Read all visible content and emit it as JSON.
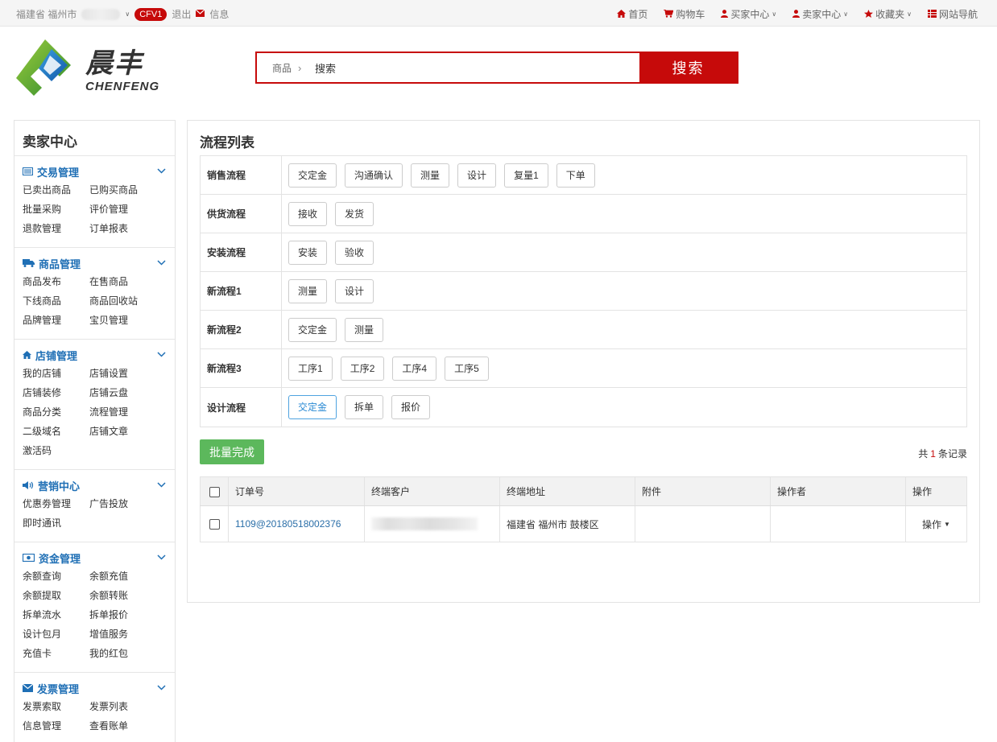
{
  "topbar": {
    "location": "福建省 福州市",
    "level_badge": "CFV1",
    "logout": "退出",
    "message": "信息",
    "nav": [
      {
        "icon": "home-icon",
        "label": "首页",
        "dropdown": false
      },
      {
        "icon": "cart-icon",
        "label": "购物车",
        "dropdown": false
      },
      {
        "icon": "user-icon",
        "label": "买家中心",
        "dropdown": true
      },
      {
        "icon": "user-icon",
        "label": "卖家中心",
        "dropdown": true
      },
      {
        "icon": "star-icon",
        "label": "收藏夹",
        "dropdown": true
      },
      {
        "icon": "grid-icon",
        "label": "网站导航",
        "dropdown": false
      }
    ]
  },
  "logo": {
    "cn": "晨丰",
    "en": "CHENFENG"
  },
  "search": {
    "category": "商品",
    "value": "搜索",
    "button": "搜索"
  },
  "sidebar": {
    "title": "卖家中心",
    "sections": [
      {
        "title": "交易管理",
        "icon": "list-icon",
        "items": [
          "已卖出商品",
          "已购买商品",
          "批量采购",
          "评价管理",
          "退款管理",
          "订单报表"
        ]
      },
      {
        "title": "商品管理",
        "icon": "truck-icon",
        "items": [
          "商品发布",
          "在售商品",
          "下线商品",
          "商品回收站",
          "品牌管理",
          "宝贝管理"
        ]
      },
      {
        "title": "店铺管理",
        "icon": "home-icon",
        "items": [
          "我的店铺",
          "店铺设置",
          "店铺装修",
          "店铺云盘",
          "商品分类",
          "流程管理",
          "二级域名",
          "店铺文章",
          "激活码"
        ]
      },
      {
        "title": "营销中心",
        "icon": "volume-icon",
        "items": [
          "优惠劵管理",
          "广告投放",
          "即时通讯"
        ]
      },
      {
        "title": "资金管理",
        "icon": "money-icon",
        "items": [
          "余额查询",
          "余额充值",
          "余额提取",
          "余额转账",
          "拆单流水",
          "拆单报价",
          "设计包月",
          "增值服务",
          "充值卡",
          "我的红包"
        ]
      },
      {
        "title": "发票管理",
        "icon": "envelope-icon",
        "items": [
          "发票索取",
          "发票列表",
          "信息管理",
          "查看账单"
        ]
      }
    ]
  },
  "main": {
    "title": "流程列表",
    "flows": [
      {
        "name": "销售流程",
        "steps": [
          "交定金",
          "沟通确认",
          "测量",
          "设计",
          "复量1",
          "下单"
        ],
        "active": -1
      },
      {
        "name": "供货流程",
        "steps": [
          "接收",
          "发货"
        ],
        "active": -1
      },
      {
        "name": "安装流程",
        "steps": [
          "安装",
          "验收"
        ],
        "active": -1
      },
      {
        "name": "新流程1",
        "steps": [
          "测量",
          "设计"
        ],
        "active": -1
      },
      {
        "name": "新流程2",
        "steps": [
          "交定金",
          "测量"
        ],
        "active": -1
      },
      {
        "name": "新流程3",
        "steps": [
          "工序1",
          "工序2",
          "工序4",
          "工序5"
        ],
        "active": -1
      },
      {
        "name": "设计流程",
        "steps": [
          "交定金",
          "拆单",
          "报价"
        ],
        "active": 0
      }
    ],
    "batch_button": "批量完成",
    "total": {
      "prefix": "共",
      "count": "1",
      "suffix": "条记录"
    },
    "table": {
      "headers": [
        "订单号",
        "终端客户",
        "终端地址",
        "附件",
        "操作者",
        "操作"
      ],
      "rows": [
        {
          "order_no": "1109@20180518002376",
          "customer": "",
          "address": "福建省 福州市 鼓楼区",
          "attachment": "",
          "operator": "",
          "action": "操作"
        }
      ]
    }
  }
}
